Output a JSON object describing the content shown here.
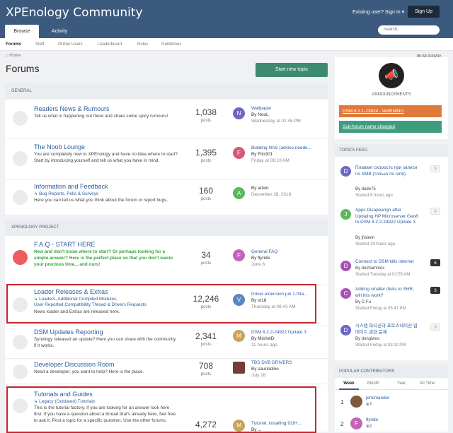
{
  "header": {
    "site_title": "XPEnology Community",
    "signin": "Existing user? Sign In ▾",
    "signup": "Sign Up",
    "tabs": [
      "Browse",
      "Activity"
    ],
    "search_placeholder": "Search..."
  },
  "subnav": [
    "Forums",
    "Staff",
    "Online Users",
    "Leaderboard",
    "Rules",
    "Guidelines"
  ],
  "breadcrumb": "Home",
  "all_activity": "All Activity",
  "page_title": "Forums",
  "new_topic": "Start new topic",
  "sections": [
    {
      "title": "GENERAL",
      "forums": [
        {
          "title": "Readers News & Rumours",
          "desc": "Tell us what is happening out there and share some spicy rumours!",
          "posts": "1,038",
          "posts_label": "posts",
          "last_avatar": "N",
          "last_title": "Wallpaper",
          "last_by": "By NooL",
          "last_date": "Wednesday at 01:45 PM"
        },
        {
          "title": "The Noob Lounge",
          "desc": "You are completely new to XPEnology and have no idea where to start? Start by introducing yourself and tell us what you have in mind.",
          "posts": "1,395",
          "posts_label": "posts",
          "last_avatar": "F",
          "last_title": "Building NAS (advise neede...",
          "last_by": "By Filo301",
          "last_date": "Friday at 06:10 AM"
        },
        {
          "title": "Information and Feedback",
          "subs": "Bug Reports,   Polls & Surveys",
          "desc": "Here you can tell us what you think about the forum or report bugs.",
          "posts": "160",
          "posts_label": "posts",
          "last_avatar": "A",
          "last_title": "",
          "last_by": "By advin",
          "last_date": "December 28, 2018"
        }
      ]
    },
    {
      "title": "XPENOLOGY PROJECT",
      "forums": [
        {
          "title": "F.A.Q - START HERE",
          "desc": "New and don't know where to start? Or perhaps looking for a simple answer? Here is the perfect place so that you don't waste your precious time... and ours!",
          "posts": "34",
          "posts_label": "posts",
          "last_avatar": "F",
          "last_title": "General FAQ",
          "last_by": "By flyride",
          "last_date": "June 6"
        },
        {
          "title": "Loader Releases & Extras",
          "subs": "Loaders,   Additional Compiled Modules,",
          "subs2": "User Reported Compatibility Thread & Drivers Requests",
          "desc": "News loader and Extras are released here.",
          "posts": "12,246",
          "posts_label": "posts",
          "last_avatar": "V",
          "last_title": "Driver extension jun 1.03a...",
          "last_by": "By vt18",
          "last_date": "Thursday at 06:43 AM"
        },
        {
          "title": "DSM Updates Reporting",
          "desc": "Synology released an update? Here you can share with the community if it works.",
          "posts": "2,341",
          "posts_label": "posts",
          "last_avatar": "M",
          "last_title": "DSM 6.2.2-24922 Update 3",
          "last_by": "By MichelD",
          "last_date": "11 hours ago"
        },
        {
          "title": "Developer Discussion Room",
          "desc": "Need a developer, you want to help? Here is the place.",
          "posts": "708",
          "posts_label": "posts",
          "last_avatar": "",
          "last_title": "TBS DVB DRIVERS",
          "last_by": "By sauriodino",
          "last_date": "July 28"
        },
        {
          "title": "Tutorials and Guides",
          "subs": "Legacy (Outdated) Tutorials",
          "desc": "This is the tutorial factory. If you are looking for an answer look here first. If you have a question about a thread that's already here, feel free to ask it. Post a topic for a specific question. Use the other forums.",
          "posts": "4,272",
          "posts_label": "posts",
          "last_avatar": "M",
          "last_title": "Tutorial: installing 918+...",
          "last_by": "By ...",
          "last_date": ""
        }
      ]
    }
  ],
  "announcements": {
    "title": "ANNOUNCEMENTS",
    "items": [
      "DSM 6.2.1-23824 - WARNING",
      "Sub-forum name changed"
    ],
    "colors": [
      "#e0793b",
      "#3f9d7f"
    ]
  },
  "topics_feed": {
    "title": "TOPICS FEED",
    "items": [
      {
        "avatar": "D",
        "title": "Плавает скорость при записи по SMB (только по smb)",
        "by": "By dude75",
        "date": "Started 8 hours ago",
        "count": "0"
      },
      {
        "avatar": "J",
        "title": "Apps Disapearign after Updating HP Microserver Gen8 to DSM 6.2.2-24922 Update 3",
        "by": "By jfisbein",
        "date": "Started 19 hours ago",
        "count": "0"
      },
      {
        "avatar": "D",
        "title": "Connect to DSM kills internet",
        "by": "By dochammoc",
        "date": "Started Tuesday at 02:55 AM",
        "count": "6"
      },
      {
        "avatar": "C",
        "title": "Adding smaller disks to SHR, will this work?",
        "by": "By C-Fu",
        "date": "Started Friday at 05:47 PM",
        "count": "3"
      },
      {
        "avatar": "D",
        "title": "시스템 파티션과 포토스테이션 업데이트 관련 문제",
        "by": "By dongiwoo",
        "date": "Started Friday at 03:11 PM",
        "count": "0"
      }
    ]
  },
  "contributors": {
    "title": "POPULAR CONTRIBUTORS",
    "tabs": [
      "Week",
      "Month",
      "Year",
      "All Time"
    ],
    "items": [
      {
        "rank": "1",
        "avatar": "",
        "name": "jensmander",
        "score": "7"
      },
      {
        "rank": "2",
        "avatar": "F",
        "name": "flyride",
        "score": "2"
      }
    ]
  }
}
